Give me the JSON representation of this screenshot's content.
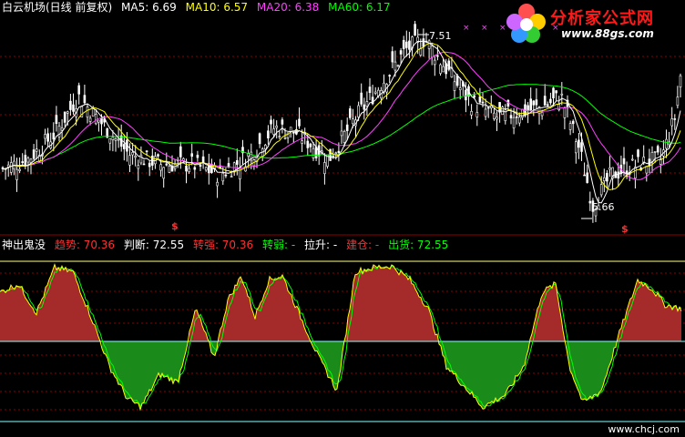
{
  "top_panel": {
    "title": "白云机场(日线 前复权)",
    "ma5": {
      "label": "MA5: 6.69",
      "color": "#ffffff"
    },
    "ma10": {
      "label": "MA10: 6.57",
      "color": "#ffff00"
    },
    "ma20": {
      "label": "MA20: 6.38",
      "color": "#ff40ff"
    },
    "ma60": {
      "label": "MA60: 6.17",
      "color": "#00ff00"
    },
    "high_label": "7.51",
    "low_label": "5.66",
    "signal_marker": "$",
    "cross_markers": "×"
  },
  "bottom_panel": {
    "indicator_name": "神出鬼没",
    "items": [
      {
        "label": "趋势: 70.36",
        "color": "#ff3030"
      },
      {
        "label": "判断: 72.55",
        "color": "#ffffff"
      },
      {
        "label": "转强: 70.36",
        "color": "#ff3030"
      },
      {
        "label": "转弱: -",
        "color": "#00ff00"
      },
      {
        "label": "拉升: -",
        "color": "#ffffff"
      },
      {
        "label": "建仓: -",
        "color": "#ff3030"
      },
      {
        "label": "出货: 72.55",
        "color": "#00ff00"
      }
    ]
  },
  "logo": {
    "name": "分析家公式网",
    "url": "www.88gs.com",
    "icon": "flower-logo-icon"
  },
  "watermark": "www.chcj.com",
  "colors": {
    "up_candle": "#ffffff",
    "down_candle": "#ffffff",
    "bull_fill": "#a52a2a",
    "bear_fill": "#1a8a1a",
    "line_yellow": "#ffff00",
    "guide_cyan": "#80ffff",
    "guide_yellow": "#ffff80"
  },
  "chart_data": {
    "type": "line",
    "price_keypoints": [
      [
        0,
        6.1
      ],
      [
        30,
        6.2
      ],
      [
        60,
        6.45
      ],
      [
        85,
        6.8
      ],
      [
        110,
        6.55
      ],
      [
        140,
        6.25
      ],
      [
        175,
        6.15
      ],
      [
        210,
        6.15
      ],
      [
        240,
        6.05
      ],
      [
        275,
        6.25
      ],
      [
        300,
        6.5
      ],
      [
        325,
        6.45
      ],
      [
        360,
        6.2
      ],
      [
        390,
        6.6
      ],
      [
        420,
        6.95
      ],
      [
        445,
        7.25
      ],
      [
        465,
        7.35
      ],
      [
        490,
        7.05
      ],
      [
        515,
        6.75
      ],
      [
        545,
        6.6
      ],
      [
        570,
        6.65
      ],
      [
        595,
        6.7
      ],
      [
        615,
        6.8
      ],
      [
        635,
        6.3
      ],
      [
        650,
        5.75
      ],
      [
        670,
        6.05
      ],
      [
        700,
        6.15
      ],
      [
        725,
        6.2
      ],
      [
        740,
        6.6
      ],
      [
        746,
        7.0
      ]
    ],
    "indicator_keypoints": [
      [
        0,
        60
      ],
      [
        20,
        70
      ],
      [
        40,
        35
      ],
      [
        60,
        90
      ],
      [
        80,
        85
      ],
      [
        100,
        30
      ],
      [
        120,
        -30
      ],
      [
        140,
        -70
      ],
      [
        155,
        -80
      ],
      [
        175,
        -40
      ],
      [
        195,
        -50
      ],
      [
        215,
        40
      ],
      [
        235,
        -20
      ],
      [
        250,
        50
      ],
      [
        265,
        80
      ],
      [
        280,
        30
      ],
      [
        295,
        75
      ],
      [
        310,
        80
      ],
      [
        330,
        30
      ],
      [
        350,
        -20
      ],
      [
        370,
        -60
      ],
      [
        390,
        85
      ],
      [
        410,
        90
      ],
      [
        430,
        92
      ],
      [
        450,
        75
      ],
      [
        470,
        40
      ],
      [
        490,
        -30
      ],
      [
        510,
        -55
      ],
      [
        530,
        -80
      ],
      [
        555,
        -65
      ],
      [
        575,
        -30
      ],
      [
        595,
        60
      ],
      [
        610,
        70
      ],
      [
        625,
        -30
      ],
      [
        640,
        -75
      ],
      [
        660,
        -60
      ],
      [
        680,
        10
      ],
      [
        700,
        75
      ],
      [
        715,
        65
      ],
      [
        730,
        45
      ],
      [
        746,
        40
      ]
    ],
    "indicator_ylim": [
      -100,
      100
    ]
  }
}
